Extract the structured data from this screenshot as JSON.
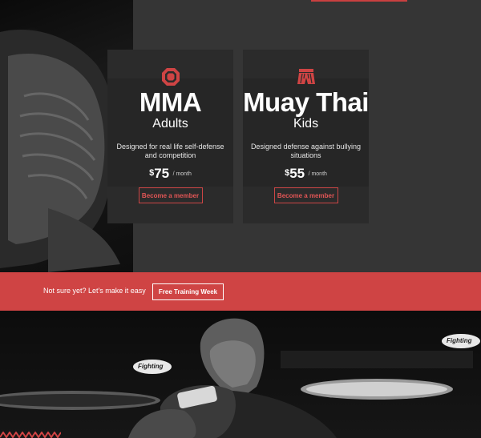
{
  "cards": [
    {
      "icon": "octagon-icon",
      "title": "MMA",
      "subtitle": "Adults",
      "description": "Designed for real life self-defense and competition",
      "price_currency": "$",
      "price_amount": "75",
      "price_period": "/ month",
      "button_label": "Become a member"
    },
    {
      "icon": "muay-thai-shorts-icon",
      "title": "Muay Thai",
      "subtitle": "Kids",
      "description": "Designed defense against bullying situations",
      "price_currency": "$",
      "price_amount": "55",
      "price_period": "/ month",
      "button_label": "Become a member"
    }
  ],
  "cta": {
    "text": "Not sure yet? Let's make it easy",
    "button_label": "Free Training Week"
  },
  "photo_signs": {
    "left": "Fighting",
    "right": "Fighting"
  },
  "colors": {
    "accent": "#cf4444",
    "background": "#353535",
    "card": "#2b2b2b",
    "card_head": "#262626"
  }
}
